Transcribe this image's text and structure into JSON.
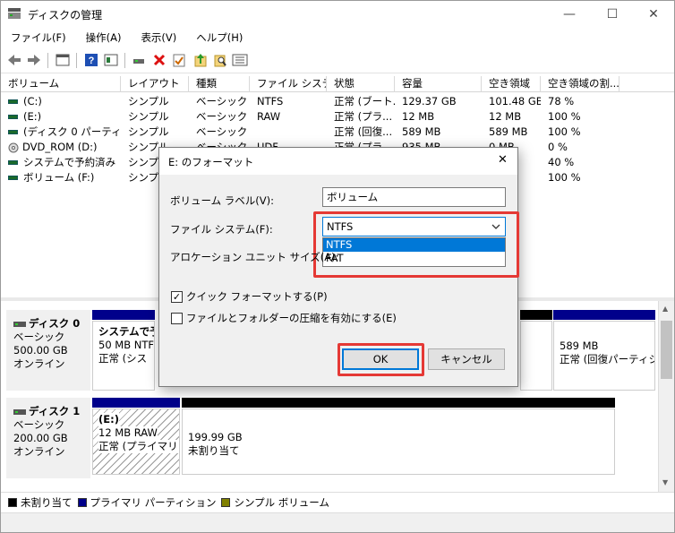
{
  "window": {
    "title": "ディスクの管理",
    "minimize": "—",
    "maximize": "☐",
    "close": "✕"
  },
  "menu": [
    "ファイル(F)",
    "操作(A)",
    "表示(V)",
    "ヘルプ(H)"
  ],
  "toolbar_icons": [
    "back-icon",
    "forward-icon",
    "properties-icon",
    "help-icon",
    "view-icon",
    "connect-icon",
    "delete-icon",
    "check-icon",
    "upload-icon",
    "search-icon",
    "list-icon"
  ],
  "table": {
    "columns": [
      "ボリューム",
      "レイアウト",
      "種類",
      "ファイル システム",
      "状態",
      "容量",
      "空き領域",
      "空き領域の割...",
      ""
    ],
    "rows": [
      [
        "(C:)",
        "シンプル",
        "ベーシック",
        "NTFS",
        "正常 (ブート...",
        "129.37 GB",
        "101.48 GB",
        "78 %"
      ],
      [
        "(E:)",
        "シンプル",
        "ベーシック",
        "RAW",
        "正常 (プラ...",
        "12 MB",
        "12 MB",
        "100 %"
      ],
      [
        "(ディスク 0 パーティシ...",
        "シンプル",
        "ベーシック",
        "",
        "正常 (回復...",
        "589 MB",
        "589 MB",
        "100 %"
      ],
      [
        "DVD_ROM (D:)",
        "シンプル",
        "ベーシック",
        "UDF",
        "正常 (プラ...",
        "935 MB",
        "0 MB",
        "0 %"
      ],
      [
        "システムで予約済み",
        "シンプル",
        "",
        "",
        "",
        "",
        "",
        "40 %"
      ],
      [
        "ボリューム (F:)",
        "シンプル",
        "",
        "",
        "",
        "",
        "",
        "100 %"
      ]
    ]
  },
  "disks": [
    {
      "name": "ディスク 0",
      "type": "ベーシック",
      "size": "500.00 GB",
      "state": "オンライン",
      "parts": [
        {
          "name": "システムで予",
          "size": "50 MB NTF",
          "status": "正常 (シス"
        },
        {
          "name": "",
          "size": "589 MB",
          "status": "正常 (回復パーティシ"
        }
      ]
    },
    {
      "name": "ディスク 1",
      "type": "ベーシック",
      "size": "200.00 GB",
      "state": "オンライン",
      "parts": [
        {
          "name": "(E:)",
          "size": "12 MB RAW",
          "status": "正常 (プライマリ パ"
        },
        {
          "name": "",
          "size": "199.99 GB",
          "status": "未割り当て"
        }
      ]
    }
  ],
  "legend": [
    {
      "label": "未割り当て",
      "color": "#000000"
    },
    {
      "label": "プライマリ パーティション",
      "color": "#00008b"
    },
    {
      "label": "シンプル ボリューム",
      "color": "#808000"
    }
  ],
  "dialog": {
    "title": "E: のフォーマット",
    "close": "✕",
    "volume_label_text": "ボリューム ラベル(V):",
    "volume_label_value": "ボリューム",
    "fs_text": "ファイル システム(F):",
    "fs_value": "NTFS",
    "fs_options": [
      "NTFS",
      "FAT"
    ],
    "alloc_text": "アロケーション ユニット サイズ(A):",
    "quick_format_text": "クイック フォーマットする(P)",
    "quick_format_checked": "✓",
    "compress_text": "ファイルとフォルダーの圧縮を有効にする(E)",
    "ok_label": "OK",
    "cancel_label": "キャンセル"
  },
  "colors": {
    "accent": "#0078d7",
    "highlight": "#e53935",
    "primary_bar": "#00008b",
    "unalloc_bar": "#000000"
  }
}
